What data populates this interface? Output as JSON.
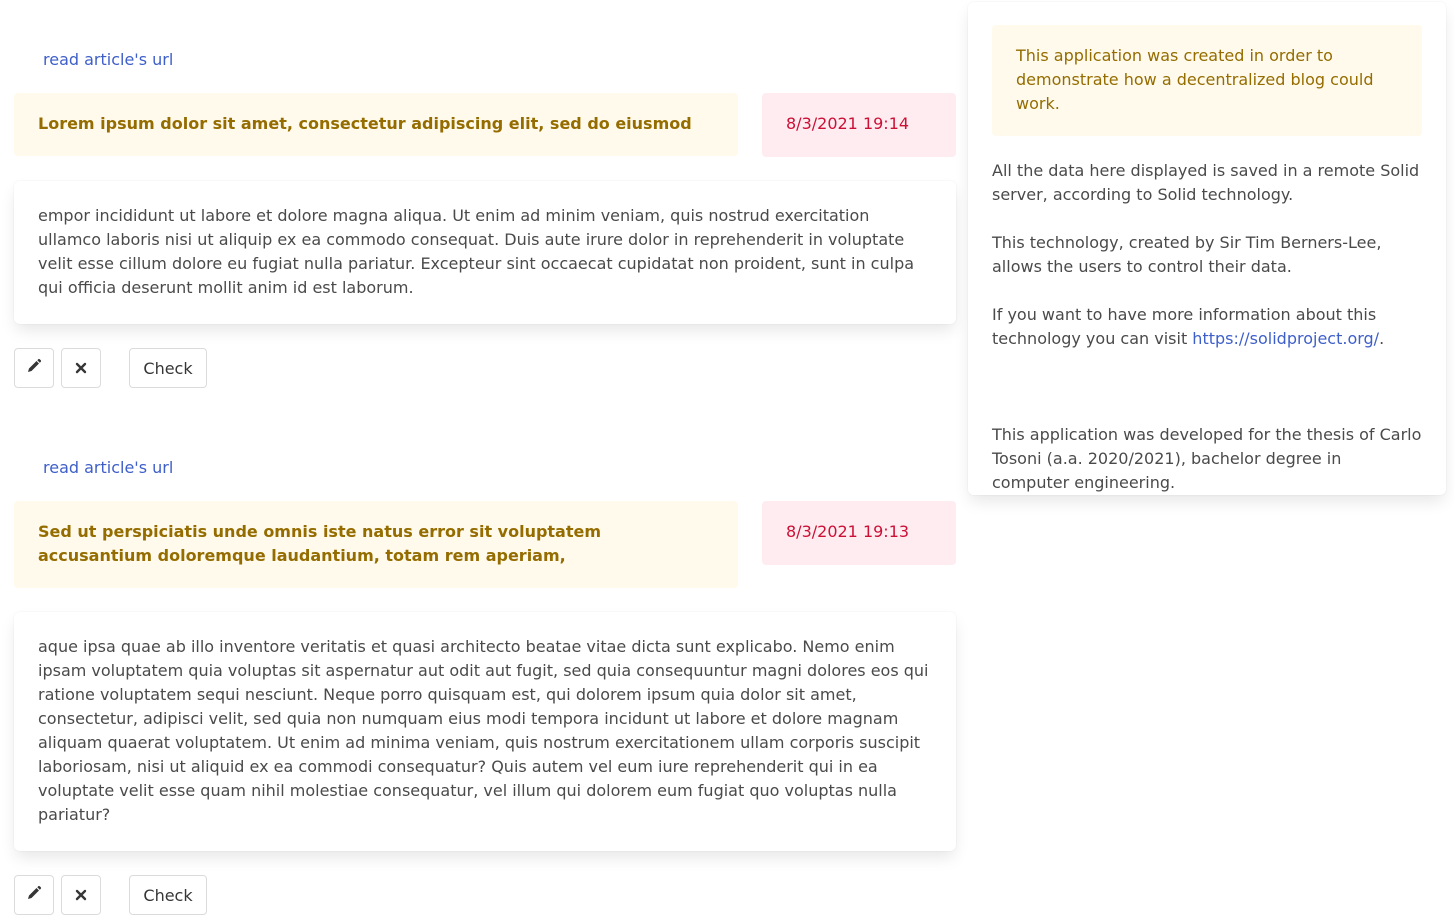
{
  "articles": [
    {
      "url_label": "read article's url",
      "title": "Lorem ipsum dolor sit amet, consectetur adipiscing elit, sed do eiusmod",
      "date": "8/3/2021 19:14",
      "body": "empor incididunt ut labore et dolore magna aliqua. Ut enim ad minim veniam, quis nostrud exercitation ullamco laboris nisi ut aliquip ex ea commodo consequat. Duis aute irure dolor in reprehenderit in voluptate velit esse cillum dolore eu fugiat nulla pariatur. Excepteur sint occaecat cupidatat non proident, sunt in culpa qui officia deserunt mollit anim id est laborum.",
      "check_label": "Check"
    },
    {
      "url_label": "read article's url",
      "title": "Sed ut perspiciatis unde omnis iste natus error sit voluptatem accusantium doloremque laudantium, totam rem aperiam,",
      "date": "8/3/2021 19:13",
      "body": "aque ipsa quae ab illo inventore veritatis et quasi architecto beatae vitae dicta sunt explicabo. Nemo enim ipsam voluptatem quia voluptas sit aspernatur aut odit aut fugit, sed quia consequuntur magni dolores eos qui ratione voluptatem sequi nesciunt. Neque porro quisquam est, qui dolorem ipsum quia dolor sit amet, consectetur, adipisci velit, sed quia non numquam eius modi tempora incidunt ut labore et dolore magnam aliquam quaerat voluptatem. Ut enim ad minima veniam, quis nostrum exercitationem ullam corporis suscipit laboriosam, nisi ut aliquid ex ea commodi consequatur? Quis autem vel eum iure reprehenderit qui in ea voluptate velit esse quam nihil molestiae consequatur, vel illum qui dolorem eum fugiat quo voluptas nulla pariatur?",
      "check_label": "Check"
    }
  ],
  "sidebar": {
    "notice": "This application was created in order to demonstrate how a decentralized blog could work.",
    "p1": "All the data here displayed is saved in a remote Solid server, according to Solid technology.",
    "p2": "This technology, created by Sir Tim Berners-Lee, allows the users to control their data.",
    "p3_prefix": "If you want to have more information about this technology you can visit ",
    "p3_link": "https://solidproject.org/",
    "p3_suffix": ".",
    "p4": "This application was developed for the thesis of Carlo Tosoni (a.a. 2020/2021), bachelor degree in computer engineering."
  },
  "icons": {
    "edit": "pencil-icon",
    "delete": "close-icon"
  }
}
